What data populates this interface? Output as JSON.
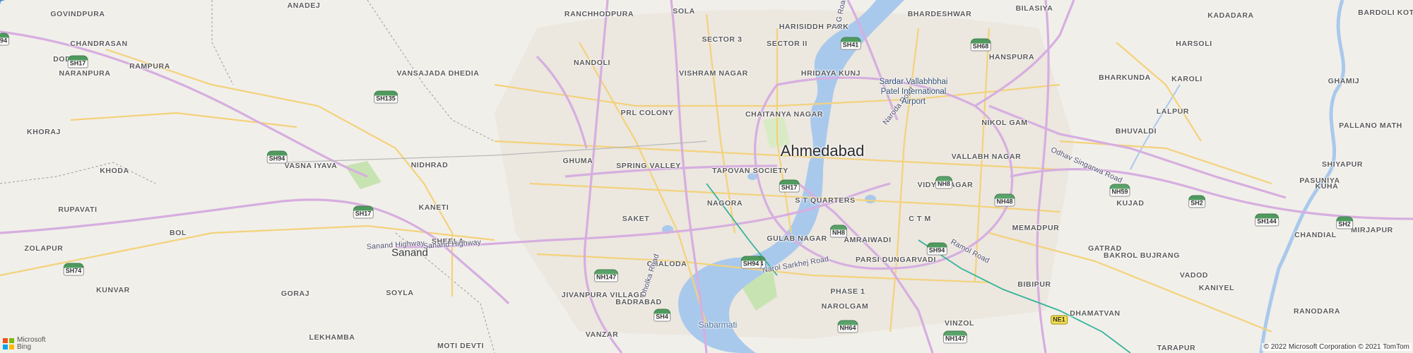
{
  "map": {
    "type": "road-map",
    "colors": {
      "land": "#f1efea",
      "urban": "#ece7df",
      "highway": "#d6aee0",
      "arterial": "#f3d27a",
      "water": "#a9c9ec",
      "park": "#c8e3b2",
      "metro_line": "#36b39a",
      "pin": "#2c4a73"
    },
    "cities": [
      {
        "key": "ahmedabad",
        "name": "Ahmedabad"
      },
      {
        "key": "sanand",
        "name": "Sanand"
      }
    ],
    "places": [
      "ANADEJ",
      "GOVINDPURA",
      "CHANDRASAN",
      "DODAR",
      "RAMPURA",
      "VANSAJADA DHEDIA",
      "NARANPURA",
      "KHORAJ",
      "KHODA",
      "VASNA IYAVA",
      "NIDHRAD",
      "RUPAVATI",
      "KANETI",
      "BOL",
      "ZOLAPUR",
      "GORAJ",
      "KUNVAR",
      "SOYLA",
      "LEKHAMBA",
      "MOTI DEVTI",
      "RANCHHODPURA",
      "SOLA",
      "SECTOR 3",
      "HARISIDDH PARK",
      "SECTOR II",
      "NANDOLI",
      "VISHRAM NAGAR",
      "HRIDAYA KUNJ",
      "PRL COLONY",
      "CHAITANYA NAGAR",
      "GHUMA",
      "SPRING VALLEY",
      "TAPOVAN SOCIETY",
      "NAGORA",
      "S T QUARTERS",
      "SAKET",
      "SHEELA",
      "GULAB NAGAR",
      "CHALODA",
      "BADRABAD",
      "JIVANPURA VILLAGE",
      "VANZAR",
      "NAROLGAM",
      "PHASE 1",
      "VINZOL",
      "PARSI DUNGARVADI",
      "AMRAIWADI",
      "C T M",
      "VIDYA NAGAR",
      "VALLABH NAGAR",
      "NIKOL GAM",
      "BHARDESHWAR",
      "BILASIYA",
      "HANSPURA",
      "KADADARA",
      "BARDOLI KOTH",
      "HARSOLI",
      "BHARKUNDA",
      "KAROLI",
      "GHAMIJ",
      "LALPUR",
      "PALLANO MATH",
      "BHUVALDI",
      "PASUNIYA",
      "SHIYAPUR",
      "KUJAD",
      "KUHA",
      "MEMADPUR",
      "CHANDIAL",
      "MIRJAPUR",
      "GATRAD",
      "BAKROL BUJRANG",
      "VADOD",
      "BIBIPUR",
      "KANIYEL",
      "DHAMATVAN",
      "RANODARA",
      "TARAPUR"
    ],
    "roads": [
      "Sanand Highway",
      "Sanand Highway",
      "Narol Sarkhej Road",
      "Naroda Road",
      "Odhav Singarwa Road",
      "Ramol Road",
      "Dholka Road",
      "S G Road"
    ],
    "water_labels": [
      "Sabarmati"
    ],
    "airport": {
      "name_line1": "Sardar Vallabhbhai",
      "name_line2": "Patel International",
      "name_line3": "Airport"
    },
    "shields": [
      {
        "label": "SH17",
        "kind": "sh"
      },
      {
        "label": "SH135",
        "kind": "sh"
      },
      {
        "label": "SH94",
        "kind": "sh"
      },
      {
        "label": "SH17",
        "kind": "sh"
      },
      {
        "label": "SH74",
        "kind": "sh"
      },
      {
        "label": "NH147",
        "kind": "nh"
      },
      {
        "label": "SH4",
        "kind": "sh"
      },
      {
        "label": "SH94",
        "kind": "sh"
      },
      {
        "label": "SH17",
        "kind": "sh"
      },
      {
        "label": "NH8",
        "kind": "nh"
      },
      {
        "label": "SH94",
        "kind": "sh"
      },
      {
        "label": "NH64",
        "kind": "nh"
      },
      {
        "label": "NH147",
        "kind": "nh"
      },
      {
        "label": "NH8",
        "kind": "nh"
      },
      {
        "label": "NH48",
        "kind": "nh"
      },
      {
        "label": "SH94",
        "kind": "sh"
      },
      {
        "label": "SH41",
        "kind": "sh"
      },
      {
        "label": "SH68",
        "kind": "sh"
      },
      {
        "label": "NH59",
        "kind": "nh"
      },
      {
        "label": "SH2",
        "kind": "sh"
      },
      {
        "label": "SH144",
        "kind": "sh"
      },
      {
        "label": "SH2",
        "kind": "sh"
      },
      {
        "label": "NE1",
        "kind": "yellow"
      },
      {
        "label": "94",
        "kind": "sh"
      }
    ],
    "attribution": {
      "brand_line1": "Microsoft",
      "brand_line2": "Bing",
      "copyright": "© 2022 Microsoft Corporation © 2021 TomTom"
    }
  }
}
